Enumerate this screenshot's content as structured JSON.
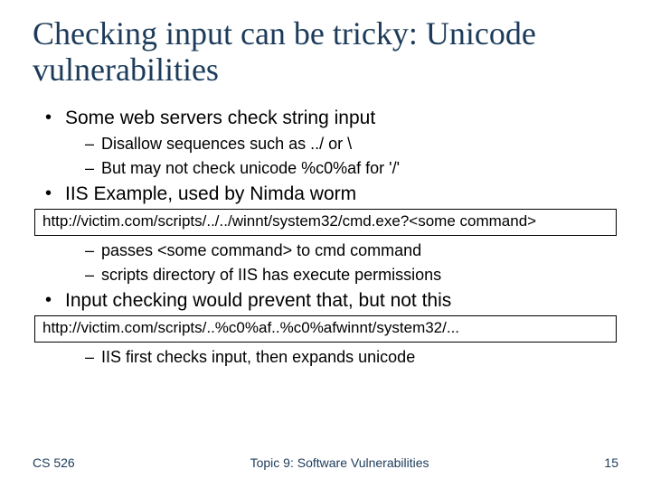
{
  "title": "Checking input can be tricky: Unicode vulnerabilities",
  "b1": "Some web servers check string input",
  "b1a": "Disallow sequences such as ../ or \\",
  "b1b": "But may not check unicode %c0%af  for  '/'",
  "b2": "IIS Example, used by Nimda worm",
  "box1": "http://victim.com/scripts/../../winnt/system32/cmd.exe?<some command>",
  "b2a": "passes <some command> to cmd command",
  "b2b": "scripts directory of IIS has execute permissions",
  "b3": "Input checking would prevent that, but not this",
  "box2": "http://victim.com/scripts/..%c0%af..%c0%afwinnt/system32/...",
  "b3a": "IIS first checks input, then expands unicode",
  "footer": {
    "left": "CS 526",
    "center": "Topic 9: Software Vulnerabilities",
    "right": "15"
  }
}
